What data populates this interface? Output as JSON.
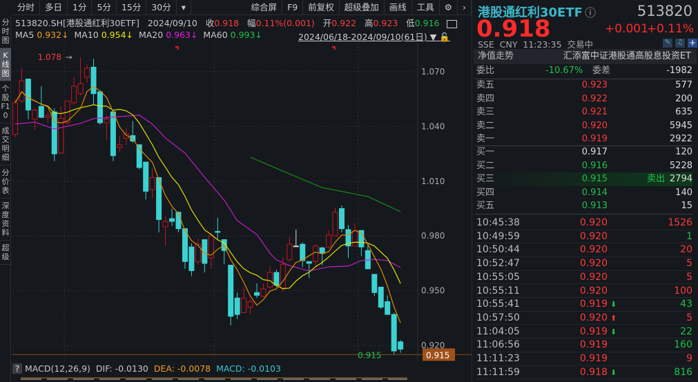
{
  "toolbar": {
    "left": [
      "分时",
      "多日",
      "1分",
      "5分",
      "15分",
      "30分",
      "▾"
    ],
    "right": [
      "综合屏",
      "F9",
      "前复权",
      "超级叠加",
      "画线",
      "工具",
      "⚙",
      "›"
    ]
  },
  "sidebar": [
    "分时图",
    "K线图",
    "个股F10",
    "成交明细",
    "分价表",
    "深度资料",
    "超级"
  ],
  "info": {
    "symbol": "513820.SH[港股通红利30ETF]",
    "date": "2024/09/10",
    "close_label": "收",
    "close": "0.918",
    "amp_label": "幅",
    "amp": "0.11%(0.001)",
    "open_label": "开",
    "open": "0.922",
    "high_label": "高",
    "high": "0.923",
    "low_label": "低",
    "low": "0.916"
  },
  "ma": {
    "ma5_label": "MA5",
    "ma5": "0.932↓",
    "ma10_label": "MA10",
    "ma10": "0.954↓",
    "ma20_label": "MA20",
    "ma20": "0.963↓",
    "ma60_label": "MA60",
    "ma60": "0.993↓"
  },
  "range": "2024/06/18-2024/09/10(61日)",
  "colors": {
    "up": "#c8141e",
    "down": "#3cd2d2",
    "ma5": "#e08a00",
    "ma10": "#e0e000",
    "ma20": "#c020c0",
    "ma60": "#1a8a1a"
  },
  "chart_data": {
    "type": "candlestick",
    "yticks": [
      "1.070",
      "1.040",
      "1.010",
      "0.980",
      "0.950",
      "0.920"
    ],
    "ylim": [
      0.9136,
      1.0832
    ],
    "max_label": "1.078",
    "min_label": "0.915",
    "last_tag": "0.915",
    "ohlc": [
      [
        1.0356,
        1.055,
        1.034,
        1.053
      ],
      [
        1.054,
        1.072,
        1.053,
        1.065
      ],
      [
        1.066,
        1.066,
        1.044,
        1.049
      ],
      [
        1.044,
        1.05,
        1.038,
        1.049
      ],
      [
        1.051,
        1.062,
        1.0445,
        1.045
      ],
      [
        1.045,
        1.048,
        1.042,
        1.046
      ],
      [
        1.048,
        1.05,
        1.021,
        1.025
      ],
      [
        1.0255,
        1.051,
        1.025,
        1.0445
      ],
      [
        1.042,
        1.054,
        1.041,
        1.054
      ],
      [
        1.053,
        1.067,
        1.052,
        1.062
      ],
      [
        1.058,
        1.078,
        1.057,
        1.0635
      ],
      [
        1.067,
        1.074,
        1.064,
        1.072
      ],
      [
        1.0725,
        1.077,
        1.052,
        1.058
      ],
      [
        1.059,
        1.059,
        1.041,
        1.042
      ],
      [
        1.042,
        1.046,
        1.0325,
        1.044
      ],
      [
        1.048,
        1.049,
        1.021,
        1.024
      ],
      [
        1.0285,
        1.035,
        1.026,
        1.03
      ],
      [
        1.0335,
        1.039,
        1.03,
        1.036
      ],
      [
        1.035,
        1.043,
        1.031,
        1.032
      ],
      [
        1.03,
        1.03,
        1.0165,
        1.0175
      ],
      [
        1.0205,
        1.0205,
        1.0,
        1.0045
      ],
      [
        1.0055,
        1.017,
        1.0005,
        1.012
      ],
      [
        1.012,
        1.012,
        0.982,
        0.989
      ],
      [
        0.985,
        0.9905,
        0.9745,
        0.988
      ],
      [
        0.9895,
        0.995,
        0.9855,
        0.988
      ],
      [
        0.993,
        0.9935,
        0.982,
        0.984
      ],
      [
        0.984,
        0.984,
        0.962,
        0.966
      ],
      [
        0.974,
        0.976,
        0.958,
        0.961
      ],
      [
        0.966,
        0.9785,
        0.9645,
        0.9755
      ],
      [
        0.978,
        0.978,
        0.96,
        0.965
      ],
      [
        0.968,
        0.9815,
        0.962,
        0.98
      ],
      [
        0.9825,
        0.99,
        0.978,
        0.982
      ],
      [
        0.978,
        0.978,
        0.9645,
        0.972
      ],
      [
        0.964,
        0.964,
        0.931,
        0.936
      ],
      [
        0.946,
        0.949,
        0.9345,
        0.937
      ],
      [
        0.938,
        0.952,
        0.938,
        0.946
      ],
      [
        0.941,
        0.9455,
        0.937,
        0.944
      ],
      [
        0.949,
        0.954,
        0.946,
        0.9475
      ],
      [
        0.947,
        0.954,
        0.9465,
        0.951
      ],
      [
        0.952,
        0.9635,
        0.951,
        0.96
      ],
      [
        0.96,
        0.9615,
        0.952,
        0.953
      ],
      [
        0.9515,
        0.9685,
        0.9495,
        0.9645
      ],
      [
        0.967,
        0.9795,
        0.966,
        0.9755
      ],
      [
        0.9745,
        0.9835,
        0.9745,
        0.9745
      ],
      [
        0.9755,
        0.9765,
        0.963,
        0.9665
      ],
      [
        0.966,
        0.966,
        0.957,
        0.965
      ],
      [
        0.966,
        0.9755,
        0.963,
        0.9745
      ],
      [
        0.9735,
        0.974,
        0.964,
        0.9705
      ],
      [
        0.974,
        0.983,
        0.9735,
        0.9805
      ],
      [
        0.98,
        0.9955,
        0.98,
        0.993
      ],
      [
        0.995,
        0.9967,
        0.982,
        0.984
      ],
      [
        0.9835,
        0.986,
        0.968,
        0.9745
      ],
      [
        0.9745,
        0.987,
        0.9745,
        0.983
      ],
      [
        0.983,
        0.983,
        0.969,
        0.974
      ],
      [
        0.972,
        0.9755,
        0.962,
        0.962
      ],
      [
        0.959,
        0.959,
        0.947,
        0.949
      ],
      [
        0.952,
        0.952,
        0.94,
        0.941
      ],
      [
        0.944,
        0.9475,
        0.937,
        0.937
      ],
      [
        0.937,
        0.938,
        0.915,
        0.917
      ],
      [
        0.922,
        0.923,
        0.916,
        0.918
      ]
    ],
    "ma20": [
      [
        0,
        1.0413
      ],
      [
        3,
        1.0424
      ],
      [
        6,
        1.0386
      ],
      [
        10,
        1.0417
      ],
      [
        12,
        1.0443
      ],
      [
        19,
        1.0462
      ],
      [
        21,
        1.0413
      ],
      [
        23,
        1.0337
      ],
      [
        26,
        1.0254
      ],
      [
        29,
        1.0122
      ],
      [
        32,
        0.9997
      ],
      [
        34,
        0.9884
      ],
      [
        37,
        0.9808
      ],
      [
        39,
        0.9706
      ],
      [
        40,
        0.9669
      ],
      [
        42,
        0.9638
      ],
      [
        45,
        0.9608
      ],
      [
        48,
        0.9631
      ],
      [
        51,
        0.9635
      ],
      [
        53,
        0.9665
      ],
      [
        55,
        0.9672
      ],
      [
        57,
        0.9665
      ],
      [
        59,
        0.9627
      ]
    ],
    "ma60": [
      [
        36,
        1.0232
      ],
      [
        42,
        1.014
      ],
      [
        47,
        1.0065
      ],
      [
        54,
        1.0016
      ],
      [
        59,
        0.9933
      ]
    ],
    "month_boundaries": [
      8,
      31,
      53
    ],
    "flags": [
      25,
      49
    ]
  },
  "macd": {
    "q": "?",
    "label": "MACD(12,26,9)",
    "dif": "DIF: -0.0130",
    "dea": "DEA: -0.0078",
    "macd": "MACD: -0.0103"
  },
  "quote": {
    "name": "港股通红利30ETF",
    "info_icon": "ⓘ",
    "code": "513820",
    "price": "0.918",
    "change": "+0.001",
    "pct": "+0.11%",
    "exchange": "SSE",
    "currency": "CNY",
    "time": "11:23:35",
    "status": "交易中",
    "nav_label": "净值走势",
    "fund_name": "汇添富中证港股通高股息投资ET",
    "wb_label": "委比",
    "wb": "-10.67%",
    "wc_label": "委差",
    "wc": "-1982"
  },
  "asks": [
    {
      "l": "卖五",
      "p": "0.923",
      "v": "577"
    },
    {
      "l": "卖四",
      "p": "0.922",
      "v": "200"
    },
    {
      "l": "卖三",
      "p": "0.921",
      "v": "635"
    },
    {
      "l": "卖二",
      "p": "0.920",
      "v": "5945"
    },
    {
      "l": "卖一",
      "p": "0.919",
      "v": "2922"
    }
  ],
  "bids": [
    {
      "l": "买一",
      "p": "0.917",
      "v": "120",
      "pc": "w"
    },
    {
      "l": "买二",
      "p": "0.916",
      "v": "5228",
      "pc": "g"
    },
    {
      "l": "买三",
      "p": "0.915",
      "v": "2794",
      "pc": "g",
      "tag": "卖出"
    },
    {
      "l": "买四",
      "p": "0.914",
      "v": "140",
      "pc": "g"
    },
    {
      "l": "买五",
      "p": "0.913",
      "v": "15",
      "pc": "g"
    }
  ],
  "trades": [
    {
      "t": "10:45:38",
      "p": "0.920",
      "v": "1526",
      "vc": "r"
    },
    {
      "t": "10:49:59",
      "p": "0.920",
      "v": "1",
      "vc": "g"
    },
    {
      "t": "10:50:44",
      "p": "0.920",
      "v": "20",
      "vc": "r"
    },
    {
      "t": "10:52:47",
      "p": "0.920",
      "v": "5",
      "vc": "r"
    },
    {
      "t": "10:55:05",
      "p": "0.920",
      "v": "5",
      "vc": "r"
    },
    {
      "t": "10:55:11",
      "p": "0.920",
      "v": "100",
      "vc": "r"
    },
    {
      "t": "10:55:41",
      "p": "0.919",
      "v": "43",
      "vc": "g",
      "arrow": "down"
    },
    {
      "t": "10:57:50",
      "p": "0.920",
      "v": "5",
      "vc": "r",
      "arrow": "up"
    },
    {
      "t": "11:04:05",
      "p": "0.919",
      "v": "22",
      "vc": "g",
      "arrow": "down"
    },
    {
      "t": "11:06:56",
      "p": "0.919",
      "v": "160",
      "vc": "g"
    },
    {
      "t": "11:11:23",
      "p": "0.919",
      "v": "9",
      "vc": "r"
    },
    {
      "t": "11:11:59",
      "p": "0.918",
      "v": "816",
      "vc": "g",
      "arrow": "down"
    }
  ]
}
